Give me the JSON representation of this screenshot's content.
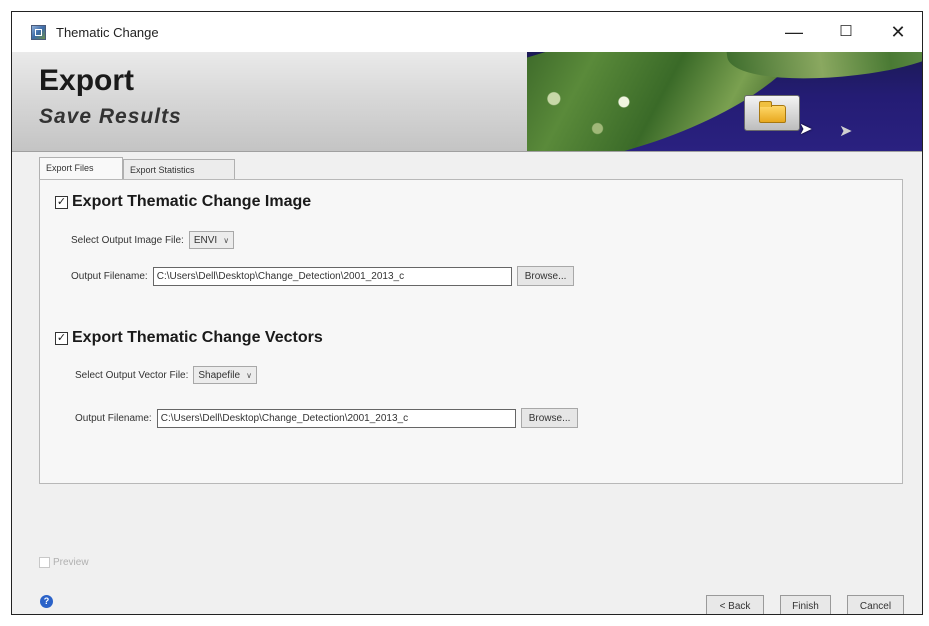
{
  "window": {
    "title": "Thematic Change",
    "controls": {
      "minimize": "—",
      "maximize": "☐",
      "close": "✕"
    }
  },
  "banner": {
    "title": "Export",
    "subtitle": "Save Results"
  },
  "tabs": [
    {
      "label": "Export Files",
      "active": true
    },
    {
      "label": "Export Statistics",
      "active": false
    }
  ],
  "image_section": {
    "checked": true,
    "check_glyph": "✓",
    "heading": "Export Thematic Change Image",
    "select_label": "Select Output Image File:",
    "select_value": "ENVI",
    "filename_label": "Output Filename:",
    "filename_value": "C:\\Users\\Dell\\Desktop\\Change_Detection\\2001_2013_c",
    "browse_label": "Browse..."
  },
  "vector_section": {
    "checked": true,
    "check_glyph": "✓",
    "heading": "Export Thematic Change Vectors",
    "select_label": "Select Output Vector File:",
    "select_value": "Shapefile",
    "filename_label": "Output Filename:",
    "filename_value": "C:\\Users\\Dell\\Desktop\\Change_Detection\\2001_2013_c",
    "browse_label": "Browse..."
  },
  "preview": {
    "label": "Preview",
    "checked": false,
    "enabled": false
  },
  "footer": {
    "help_glyph": "?",
    "back_label": "< Back",
    "finish_label": "Finish",
    "cancel_label": "Cancel"
  },
  "icons": {
    "app": "app-icon",
    "folder": "folder-icon",
    "cursor": "mouse-cursor-icon",
    "help": "help-icon",
    "dropdown": "chevron-down-icon"
  }
}
